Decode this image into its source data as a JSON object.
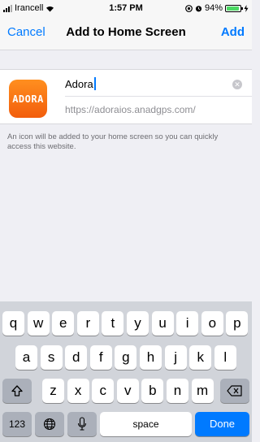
{
  "status_bar": {
    "carrier": "Irancell",
    "time": "1:57 PM",
    "battery_text": "94%",
    "battery_level": 0.94,
    "icons": [
      "signal-icon",
      "wifi-icon",
      "location-icon",
      "alarm-icon",
      "battery-icon",
      "charging-icon"
    ]
  },
  "navbar": {
    "cancel_label": "Cancel",
    "title": "Add to Home Screen",
    "add_label": "Add"
  },
  "bookmark": {
    "icon_text": "ADORA",
    "name_value": "Adora",
    "url": "https://adoraios.anadgps.com/"
  },
  "helper_text": "An icon will be added to your home screen so you can quickly access this website.",
  "keyboard": {
    "row1": [
      "q",
      "w",
      "e",
      "r",
      "t",
      "y",
      "u",
      "i",
      "o",
      "p"
    ],
    "row2": [
      "a",
      "s",
      "d",
      "f",
      "g",
      "h",
      "j",
      "k",
      "l"
    ],
    "row3": [
      "z",
      "x",
      "c",
      "v",
      "b",
      "n",
      "m"
    ],
    "numbers_label": "123",
    "space_label": "space",
    "done_label": "Done"
  },
  "colors": {
    "accent": "#007aff",
    "background": "#efeff4",
    "app_icon": "#f47a15",
    "keyboard": "#d1d4da"
  }
}
